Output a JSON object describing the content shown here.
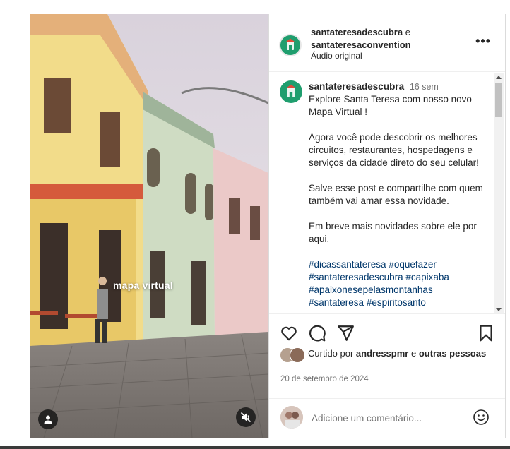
{
  "media": {
    "overlay_text": "mapa virtual",
    "tags_icon": "user-tag-icon",
    "mute_icon": "speaker-muted-icon"
  },
  "post_header": {
    "author_primary": "santateresadescubra",
    "conjunction": "e",
    "author_secondary": "santateresaconvention",
    "audio_label": "Áudio original",
    "more_icon": "more-horizontal-icon",
    "more_label": "•••"
  },
  "caption": {
    "username": "santateresadescubra",
    "time_ago": "16 sem",
    "paragraphs": [
      "Explore Santa Teresa com nosso novo Mapa Virtual !",
      "Agora você pode descobrir os melhores circuitos, restaurantes, hospedagens e serviços da cidade direto do seu celular!",
      "Salve esse post e compartilhe com quem também vai amar essa novidade.",
      "Em breve mais novidades sobre ele por aqui."
    ],
    "hashtags": [
      "#dicassantateresa",
      "#oquefazer",
      "#santateresadescubra",
      "#capixaba",
      "#apaixonesepelasmontanhas",
      "#santateresa",
      "#espiritosanto"
    ]
  },
  "actions": {
    "like_icon": "heart-icon",
    "comment_icon": "comment-icon",
    "share_icon": "send-icon",
    "save_icon": "bookmark-icon"
  },
  "likes": {
    "prefix": "Curtido por ",
    "user": "andresspmr",
    "middle": " e ",
    "others": "outras pessoas"
  },
  "date": "20 de setembro de 2024",
  "comment": {
    "placeholder": "Adicione um comentário...",
    "emoji_icon": "emoji-smile-icon"
  },
  "colors": {
    "brand_green": "#1f9e6e",
    "hashtag_blue": "#00376b",
    "muted_text": "#737373",
    "border": "#dbdbdb"
  }
}
